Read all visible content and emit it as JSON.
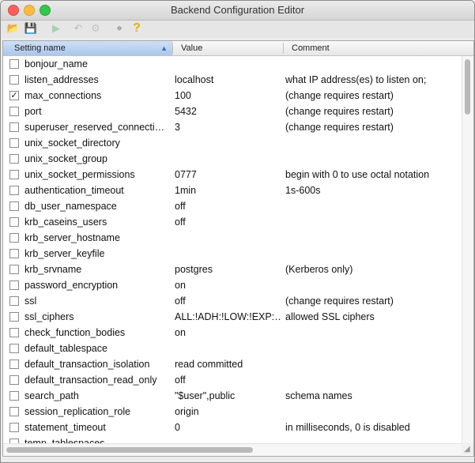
{
  "window": {
    "title": "Backend Configuration Editor"
  },
  "toolbar": {
    "icons": [
      {
        "name": "open-folder-icon",
        "glyph": "📂",
        "enabled": true
      },
      {
        "name": "save-icon",
        "glyph": "💾",
        "enabled": true
      },
      {
        "name": "execute-icon",
        "glyph": "▶",
        "enabled": false
      },
      {
        "name": "reload-icon",
        "glyph": "↶",
        "enabled": false
      },
      {
        "name": "settings-icon",
        "glyph": "⚙",
        "enabled": false
      },
      {
        "name": "cursor-icon",
        "glyph": "⌖",
        "enabled": true
      },
      {
        "name": "help-icon",
        "glyph": "?",
        "enabled": true
      }
    ]
  },
  "table": {
    "columns": {
      "name": "Setting name",
      "value": "Value",
      "comment": "Comment"
    },
    "rows": [
      {
        "checked": false,
        "name": "bonjour_name",
        "value": "",
        "comment": ""
      },
      {
        "checked": false,
        "name": "listen_addresses",
        "value": "localhost",
        "comment": "what IP address(es) to listen on;"
      },
      {
        "checked": true,
        "name": "max_connections",
        "value": "100",
        "comment": "(change requires restart)"
      },
      {
        "checked": false,
        "name": "port",
        "value": "5432",
        "comment": "(change requires restart)"
      },
      {
        "checked": false,
        "name": "superuser_reserved_connecti…",
        "value": "3",
        "comment": "(change requires restart)"
      },
      {
        "checked": false,
        "name": "unix_socket_directory",
        "value": "",
        "comment": ""
      },
      {
        "checked": false,
        "name": "unix_socket_group",
        "value": "",
        "comment": ""
      },
      {
        "checked": false,
        "name": "unix_socket_permissions",
        "value": "0777",
        "comment": "begin with 0 to use octal notation"
      },
      {
        "checked": false,
        "name": "authentication_timeout",
        "value": "1min",
        "comment": "1s-600s"
      },
      {
        "checked": false,
        "name": "db_user_namespace",
        "value": "off",
        "comment": ""
      },
      {
        "checked": false,
        "name": "krb_caseins_users",
        "value": "off",
        "comment": ""
      },
      {
        "checked": false,
        "name": "krb_server_hostname",
        "value": "",
        "comment": ""
      },
      {
        "checked": false,
        "name": "krb_server_keyfile",
        "value": "",
        "comment": ""
      },
      {
        "checked": false,
        "name": "krb_srvname",
        "value": "postgres",
        "comment": "(Kerberos only)"
      },
      {
        "checked": false,
        "name": "password_encryption",
        "value": "on",
        "comment": ""
      },
      {
        "checked": false,
        "name": "ssl",
        "value": "off",
        "comment": "(change requires restart)"
      },
      {
        "checked": false,
        "name": "ssl_ciphers",
        "value": "ALL:!ADH:!LOW:!EXP:…",
        "comment": "allowed SSL ciphers"
      },
      {
        "checked": false,
        "name": "check_function_bodies",
        "value": "on",
        "comment": ""
      },
      {
        "checked": false,
        "name": "default_tablespace",
        "value": "",
        "comment": ""
      },
      {
        "checked": false,
        "name": "default_transaction_isolation",
        "value": "read committed",
        "comment": ""
      },
      {
        "checked": false,
        "name": "default_transaction_read_only",
        "value": "off",
        "comment": ""
      },
      {
        "checked": false,
        "name": "search_path",
        "value": "\"$user\",public",
        "comment": "schema names"
      },
      {
        "checked": false,
        "name": "session_replication_role",
        "value": "origin",
        "comment": ""
      },
      {
        "checked": false,
        "name": "statement_timeout",
        "value": "0",
        "comment": "in milliseconds, 0 is disabled"
      },
      {
        "checked": false,
        "name": "temp_tablespaces",
        "value": "",
        "comment": ""
      }
    ]
  },
  "colors": {
    "sorted_header": "#a9c6ea",
    "close": "#fc605b",
    "minimize": "#fdbc40",
    "maximize": "#34c84a"
  }
}
